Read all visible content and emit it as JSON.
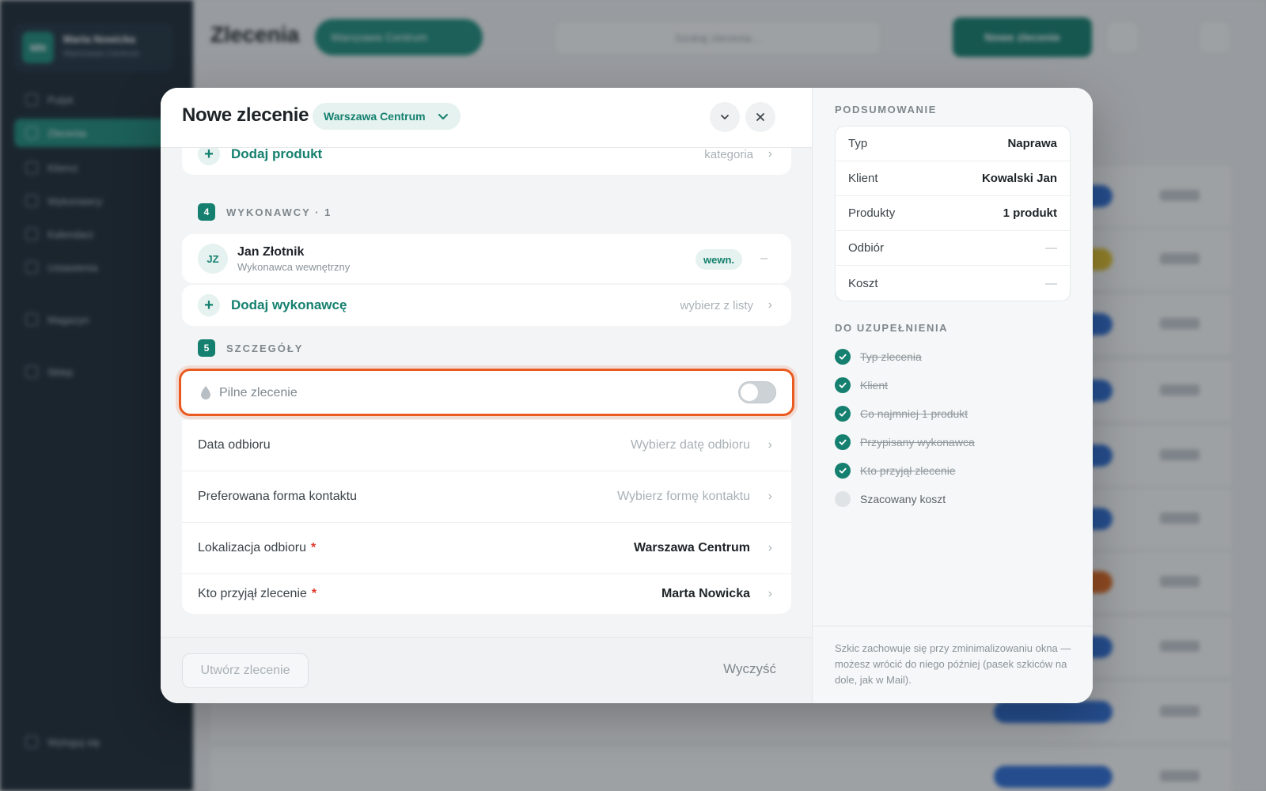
{
  "background": {
    "user": {
      "initials": "MN",
      "name": "Marta Nowicka",
      "role": "Warszawa Centrum"
    },
    "nav": [
      "Pulpit",
      "Zlecenia",
      "Klienci",
      "Wykonawcy",
      "Kalendarz",
      "Ustawienia",
      "Magazyn",
      "Sklep"
    ],
    "nav_bottom": "Wyloguj się",
    "page_title": "Zlecenia",
    "location": "Warszawa Centrum",
    "search_placeholder": "Szukaj zlecenia...",
    "new_button": "Nowe zlecenie"
  },
  "modal": {
    "title": "Nowe zlecenie",
    "location": "Warszawa Centrum",
    "add_product": {
      "label": "Dodaj produkt",
      "hint": "kategoria"
    },
    "section4": {
      "number": "4",
      "label": "WYKONAWCY · 1"
    },
    "contractor": {
      "initials": "JZ",
      "name": "Jan Złotnik",
      "role": "Wykonawca wewnętrzny",
      "tag": "wewn.",
      "action": "–"
    },
    "add_contractor": {
      "label": "Dodaj wykonawcę",
      "hint": "wybierz z listy"
    },
    "section5": {
      "number": "5",
      "label": "SZCZEGÓŁY"
    },
    "urgent": {
      "label": "Pilne zlecenie",
      "enabled": false
    },
    "details": [
      {
        "label": "Data odbioru",
        "value": "Wybierz datę odbioru",
        "required": false,
        "placeholder": true
      },
      {
        "label": "Preferowana forma kontaktu",
        "value": "Wybierz formę kontaktu",
        "required": false,
        "placeholder": true
      },
      {
        "label": "Lokalizacja odbioru",
        "value": "Warszawa Centrum",
        "required": true,
        "placeholder": false
      },
      {
        "label": "Kto przyjął zlecenie",
        "value": "Marta Nowicka",
        "required": true,
        "placeholder": false
      }
    ],
    "required_mark": "*",
    "create_button": "Utwórz zlecenie",
    "clear_button": "Wyczyść"
  },
  "summary": {
    "heading": "PODSUMOWANIE",
    "rows": [
      {
        "key": "Typ",
        "value": "Naprawa"
      },
      {
        "key": "Klient",
        "value": "Kowalski Jan"
      },
      {
        "key": "Produkty",
        "value": "1 produkt"
      },
      {
        "key": "Odbiór",
        "value": "—"
      },
      {
        "key": "Koszt",
        "value": "—"
      }
    ],
    "todo_heading": "DO UZUPEŁNIENIA",
    "todo": [
      {
        "label": "Typ zlecenia",
        "done": true
      },
      {
        "label": "Klient",
        "done": true
      },
      {
        "label": "Co najmniej 1 produkt",
        "done": true
      },
      {
        "label": "Przypisany wykonawca",
        "done": true
      },
      {
        "label": "Kto przyjął zlecenie",
        "done": true
      },
      {
        "label": "Szacowany koszt",
        "done": false
      }
    ],
    "note": "Szkic zachowuje się przy zminimalizowaniu okna — możesz wrócić do niego później (pasek szkiców na dole, jak w Mail)."
  },
  "colors": {
    "accent": "#15806f",
    "highlight": "#ea5a1f",
    "required": "#e0372a"
  }
}
